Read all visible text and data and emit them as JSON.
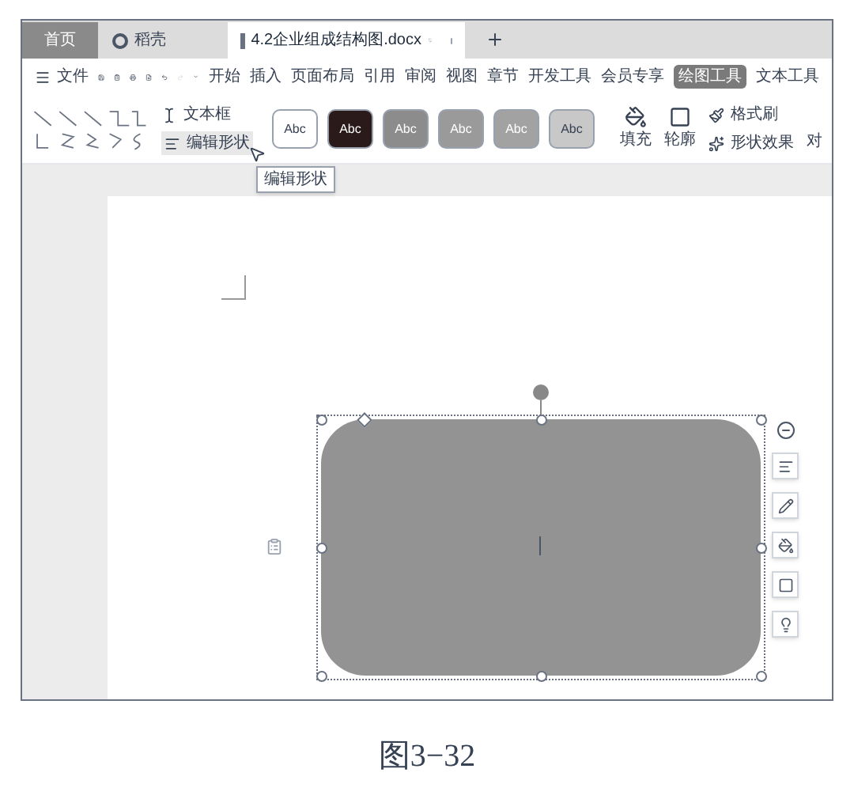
{
  "tabs": [
    {
      "label": "首页",
      "selected": false,
      "kind": "home"
    },
    {
      "label": "稻壳",
      "selected": false,
      "kind": "docer"
    },
    {
      "label": "4.2企业组成结构图.docx",
      "selected": true,
      "kind": "document"
    }
  ],
  "menu": {
    "file": "文件",
    "items": [
      {
        "label": "开始",
        "selected": false
      },
      {
        "label": "插入",
        "selected": false
      },
      {
        "label": "页面布局",
        "selected": false
      },
      {
        "label": "引用",
        "selected": false
      },
      {
        "label": "审阅",
        "selected": false
      },
      {
        "label": "视图",
        "selected": false
      },
      {
        "label": "章节",
        "selected": false
      },
      {
        "label": "开发工具",
        "selected": false
      },
      {
        "label": "会员专享",
        "selected": false
      },
      {
        "label": "绘图工具",
        "selected": true
      },
      {
        "label": "文本工具",
        "selected": false
      }
    ]
  },
  "ribbon": {
    "text_box": "文本框",
    "edit_shape": "编辑形状",
    "styles": [
      {
        "label": "Abc",
        "color": "#ffffff"
      },
      {
        "label": "Abc",
        "color": "#2a1a1a"
      },
      {
        "label": "Abc",
        "color": "#8c8c8c"
      },
      {
        "label": "Abc",
        "color": "#9a9a9a"
      },
      {
        "label": "Abc",
        "color": "#a2a2a2"
      },
      {
        "label": "Abc",
        "color": "#c8c8c8"
      }
    ],
    "fill": "填充",
    "outline": "轮廓",
    "format_painter": "格式刷",
    "shape_effects": "形状效果",
    "cut_label": "对"
  },
  "tooltip": "编辑形状",
  "caption": "图3−32"
}
